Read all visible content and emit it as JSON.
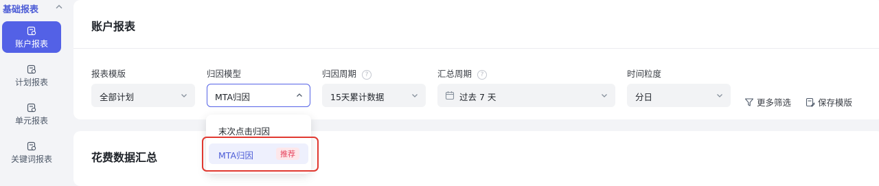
{
  "sidebar": {
    "section_title": "基础报表",
    "items": [
      {
        "label": "账户报表",
        "icon": "report-icon",
        "active": true
      },
      {
        "label": "计划报表",
        "icon": "report-icon",
        "active": false
      },
      {
        "label": "单元报表",
        "icon": "report-icon",
        "active": false
      },
      {
        "label": "关键词报表",
        "icon": "report-icon",
        "active": false
      }
    ]
  },
  "main": {
    "title": "账户报表",
    "filters": {
      "template": {
        "label": "报表模版",
        "value": "全部计划"
      },
      "attribution_model": {
        "label": "归因模型",
        "value": "MTA归因"
      },
      "attribution_period": {
        "label": "归因周期",
        "value": "15天累计数据"
      },
      "summary_period": {
        "label": "汇总周期",
        "value": "过去 7 天"
      },
      "granularity": {
        "label": "时间粒度",
        "value": "分日"
      }
    },
    "actions": {
      "more_filters": "更多筛选",
      "save_template": "保存模版"
    },
    "summary_title": "花费数据汇总"
  },
  "dropdown": {
    "options": [
      {
        "label": "末次点击归因"
      },
      {
        "label": "MTA归因",
        "badge": "推荐",
        "selected": true
      }
    ]
  },
  "colors": {
    "accent": "#5361e6",
    "highlight": "#e0382f",
    "badge_bg": "#fde7ea",
    "badge_text": "#e6455e"
  }
}
